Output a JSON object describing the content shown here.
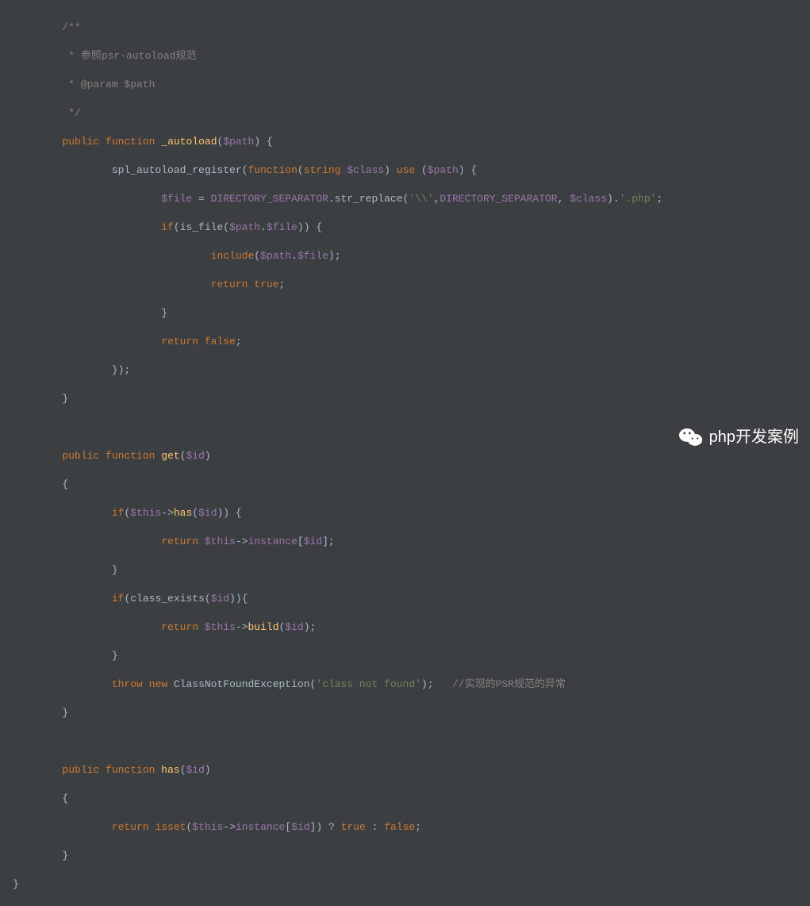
{
  "code": {
    "comment_block_open": "/**",
    "comment_line1": " * 参照psr-autoload规范",
    "comment_line2": " * @param $path",
    "comment_block_close": " */",
    "kw_public": "public",
    "kw_function": "function",
    "kw_use": "use",
    "kw_string": "string",
    "kw_if": "if",
    "kw_return": "return",
    "kw_true": "true",
    "kw_false": "false",
    "kw_throw": "throw",
    "kw_new": "new",
    "kw_isset": "isset",
    "fn_autoload": "_autoload",
    "fn_get": "get",
    "fn_has": "has",
    "fn_spl": "spl_autoload_register",
    "fn_str_replace": "str_replace",
    "fn_is_file": "is_file",
    "fn_include": "include",
    "fn_class_exists": "class_exists",
    "fn_build": "build",
    "var_path": "$path",
    "var_class": "$class",
    "var_file": "$file",
    "var_id": "$id",
    "var_this": "$this",
    "const_dirsep": "DIRECTORY_SEPARATOR",
    "str_backslash": "'\\\\'",
    "str_php": "'.php'",
    "str_notfound": "'class not found'",
    "prop_instance": "instance",
    "class_exception": "ClassNotFoundException",
    "comment_psr": "//实现的PSR规范的异常",
    "q_true": "? true :",
    "punct_dot": ".",
    "punct_comma": ",",
    "punct_semi": ";",
    "punct_arrow": "->",
    "punct_open_paren": "(",
    "punct_close_paren": ")",
    "punct_open_brace": "{",
    "punct_close_brace": "}",
    "punct_open_bracket": "[",
    "punct_close_bracket": "]",
    "punct_eq": " = "
  },
  "watermark": {
    "text": "php开发案例"
  }
}
